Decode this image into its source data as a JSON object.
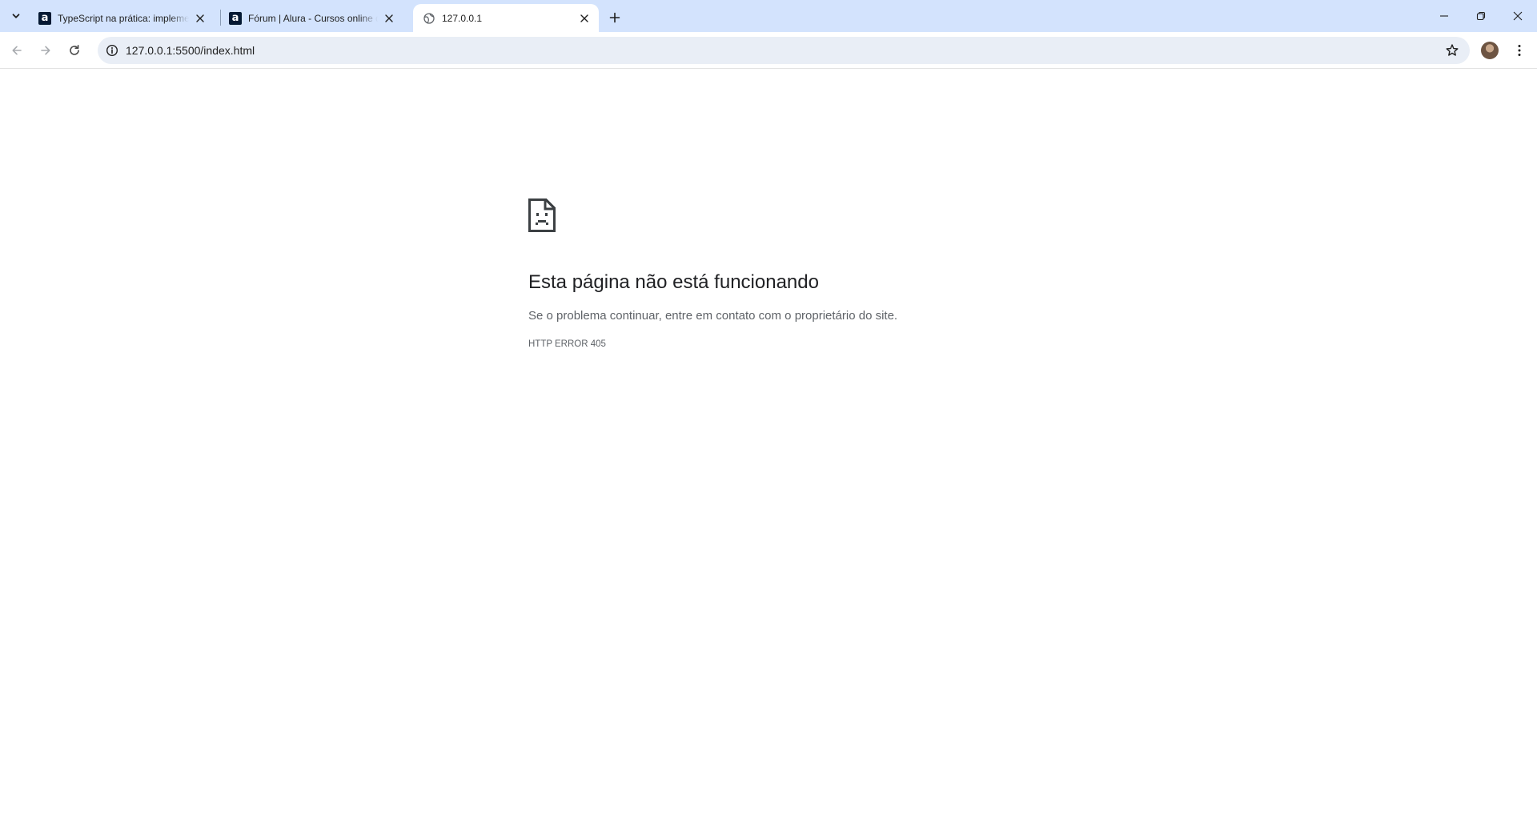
{
  "browser": {
    "tabs": [
      {
        "title": "TypeScript na prática: implementações",
        "favicon": "alura-icon",
        "active": false
      },
      {
        "title": "Fórum | Alura - Cursos online de tecnologia",
        "favicon": "alura-icon",
        "active": false
      },
      {
        "title": "127.0.0.1",
        "favicon": "globe-icon",
        "active": true
      }
    ],
    "favicon_glyph": "a",
    "address_bar": {
      "url": "127.0.0.1:5500/index.html"
    },
    "colors": {
      "tab_strip": "#d3e3fd",
      "omnibox": "#e9eef6",
      "alura_brand": "#051933"
    }
  },
  "error_page": {
    "icon": "sad-document-icon",
    "title": "Esta página não está funcionando",
    "message": "Se o problema continuar, entre em contato com o proprietário do site.",
    "code": "HTTP ERROR 405"
  }
}
